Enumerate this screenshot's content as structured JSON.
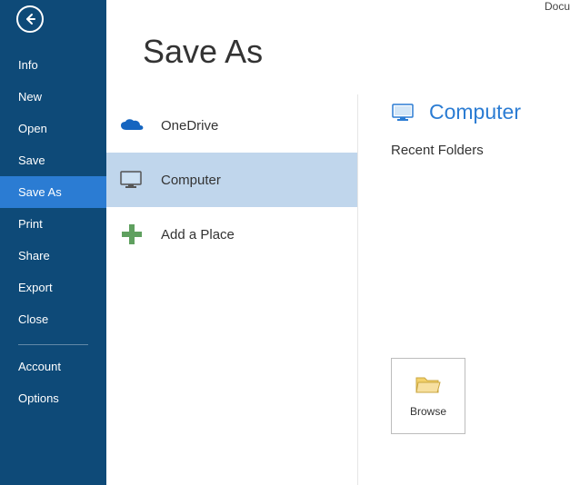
{
  "topRight": "Docu",
  "pageTitle": "Save As",
  "sidebar": {
    "items": [
      {
        "label": "Info"
      },
      {
        "label": "New"
      },
      {
        "label": "Open"
      },
      {
        "label": "Save"
      },
      {
        "label": "Save As",
        "active": true
      },
      {
        "label": "Print"
      },
      {
        "label": "Share"
      },
      {
        "label": "Export"
      },
      {
        "label": "Close"
      }
    ],
    "footer": [
      {
        "label": "Account"
      },
      {
        "label": "Options"
      }
    ]
  },
  "places": {
    "onedrive": "OneDrive",
    "computer": "Computer",
    "addplace": "Add a Place"
  },
  "rightPane": {
    "title": "Computer",
    "recent": "Recent Folders",
    "browse": "Browse"
  }
}
